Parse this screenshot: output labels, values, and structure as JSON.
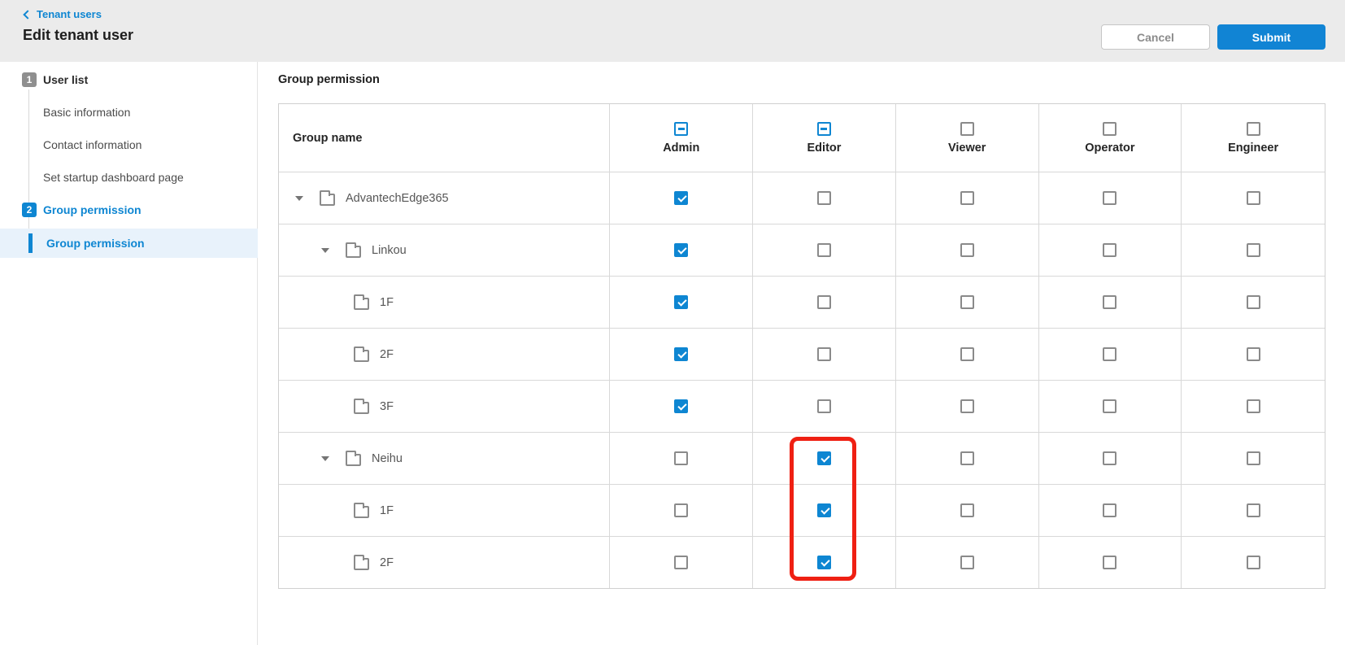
{
  "header": {
    "breadcrumb": "Tenant users",
    "title": "Edit tenant user",
    "cancel_label": "Cancel",
    "submit_label": "Submit"
  },
  "sidebar": {
    "steps": [
      {
        "number": "1",
        "label": "User list",
        "active": false,
        "children": [
          "Basic information",
          "Contact information",
          "Set startup dashboard page"
        ]
      },
      {
        "number": "2",
        "label": "Group permission",
        "active": true,
        "children": [
          "Group permission"
        ]
      }
    ],
    "active_child": "Group permission"
  },
  "main": {
    "section_title": "Group permission",
    "table": {
      "group_name_header": "Group name",
      "columns": [
        {
          "label": "Admin",
          "header_state": "indeterminate"
        },
        {
          "label": "Editor",
          "header_state": "indeterminate"
        },
        {
          "label": "Viewer",
          "header_state": "unchecked"
        },
        {
          "label": "Operator",
          "header_state": "unchecked"
        },
        {
          "label": "Engineer",
          "header_state": "unchecked"
        }
      ],
      "rows": [
        {
          "name": "AdvantechEdge365",
          "level": 1,
          "expandable": true,
          "checks": [
            true,
            false,
            false,
            false,
            false
          ]
        },
        {
          "name": "Linkou",
          "level": 2,
          "expandable": true,
          "checks": [
            true,
            false,
            false,
            false,
            false
          ]
        },
        {
          "name": "1F",
          "level": 3,
          "expandable": false,
          "checks": [
            true,
            false,
            false,
            false,
            false
          ]
        },
        {
          "name": "2F",
          "level": 3,
          "expandable": false,
          "checks": [
            true,
            false,
            false,
            false,
            false
          ]
        },
        {
          "name": "3F",
          "level": 3,
          "expandable": false,
          "checks": [
            true,
            false,
            false,
            false,
            false
          ]
        },
        {
          "name": "Neihu",
          "level": 2,
          "expandable": true,
          "checks": [
            false,
            true,
            false,
            false,
            false
          ]
        },
        {
          "name": "1F",
          "level": 3,
          "expandable": false,
          "checks": [
            false,
            true,
            false,
            false,
            false
          ]
        },
        {
          "name": "2F",
          "level": 3,
          "expandable": false,
          "checks": [
            false,
            true,
            false,
            false,
            false
          ]
        }
      ]
    },
    "annotation": {
      "description": "red box around Editor checkboxes of Neihu, 1F, 2F rows",
      "color": "#ef2013"
    }
  },
  "colors": {
    "accent_blue": "#0e86d2",
    "topbar_background": "#ebebeb",
    "active_item_background": "#e8f2fb",
    "annotation_red": "#ef2013",
    "checkbox_checked": "#0e86d2",
    "table_border": "#d8d8d8"
  }
}
